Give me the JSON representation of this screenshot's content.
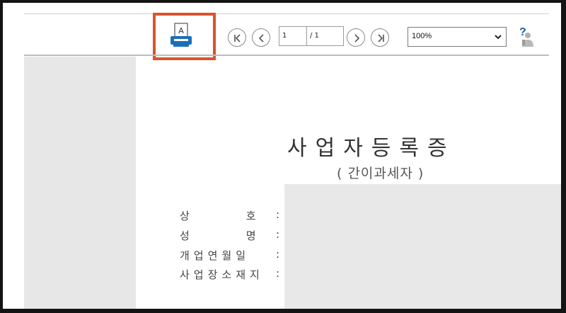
{
  "toolbar": {
    "print_icon_letter": "A",
    "page_current": "1",
    "page_total": "/ 1",
    "zoom_value": "100%",
    "help_symbol": "?"
  },
  "document": {
    "title": "사업자등록증",
    "subtitle": "( 간이과세자 )",
    "fields": [
      {
        "label": "상호",
        "colon": ":"
      },
      {
        "label": "성명",
        "colon": ":"
      },
      {
        "label": "개업연월일",
        "colon": ":"
      },
      {
        "label": "사업장소재지",
        "colon": ":"
      }
    ]
  },
  "colors": {
    "highlight": "#d9532c",
    "printer": "#1a6fb8",
    "panel": "#e7e7e7"
  },
  "icons": [
    "print-icon",
    "first-page-icon",
    "prev-page-icon",
    "next-page-icon",
    "last-page-icon",
    "chevron-down-icon",
    "help-icon"
  ]
}
